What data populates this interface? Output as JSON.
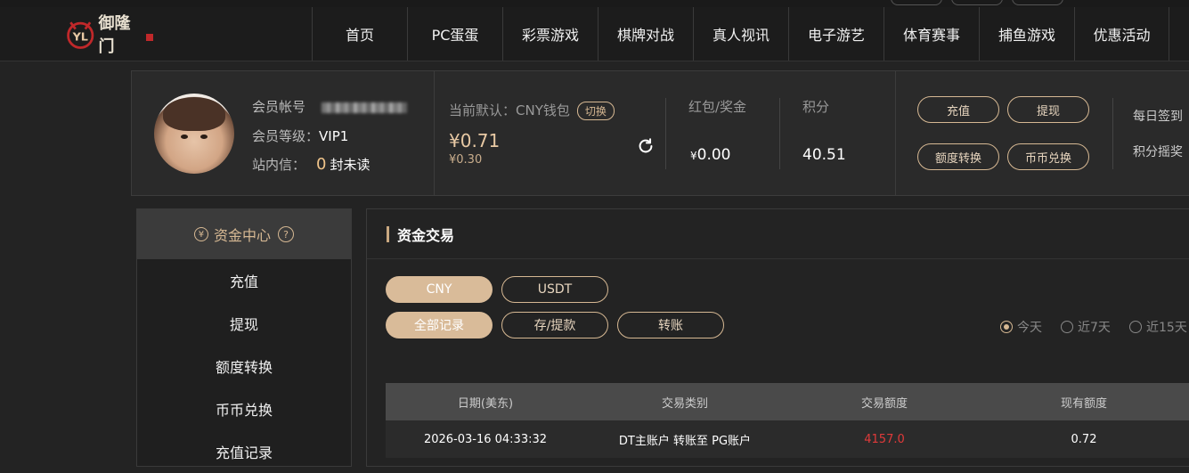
{
  "header": {
    "logo_text": "御隆门",
    "nav": [
      "首页",
      "PC蛋蛋",
      "彩票游戏",
      "棋牌对战",
      "真人视讯",
      "电子游艺",
      "体育赛事",
      "捕鱼游戏",
      "优惠活动"
    ]
  },
  "member": {
    "account_label": "会员帐号",
    "level_label": "会员等级：",
    "level_value": "VIP1",
    "inbox_label": "站内信：",
    "inbox_count": "0",
    "inbox_suffix": "封未读",
    "wallet_title": "当前默认：CNY钱包",
    "switch_label": "切换",
    "balance": "¥0.71",
    "balance_sub": "¥0.30",
    "bonus_label": "红包/奖金",
    "bonus_currency": "¥",
    "bonus_value": "0.00",
    "points_label": "积分",
    "points_value": "40.51",
    "buttons": {
      "deposit": "充值",
      "withdraw": "提现",
      "transfer": "额度转换",
      "exchange": "币币兑换"
    },
    "daily_signin": "每日签到",
    "points_lottery": "积分摇奖"
  },
  "sidebar": {
    "title": "资金中心",
    "title_icon": "¥",
    "help_icon": "?",
    "items": [
      "充值",
      "提现",
      "额度转换",
      "币币兑换",
      "充值记录"
    ]
  },
  "main": {
    "title": "资金交易",
    "currency_tabs": [
      "CNY",
      "USDT"
    ],
    "record_tabs": [
      "全部记录",
      "存/提款",
      "转账"
    ],
    "date_filters": [
      "今天",
      "近7天",
      "近15天"
    ],
    "table": {
      "headers": [
        "日期(美东)",
        "交易类别",
        "交易额度",
        "现有额度"
      ],
      "rows": [
        [
          "2026-03-16 04:33:32",
          "DT主账户 转账至 PG账户",
          "4157.0",
          "0.72"
        ]
      ]
    }
  }
}
